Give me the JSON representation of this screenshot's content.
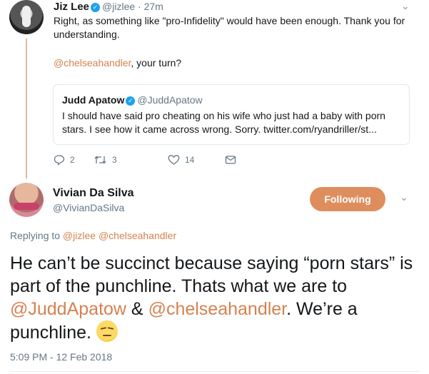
{
  "tweet1": {
    "name": "Jiz Lee",
    "handle": "@jizlee",
    "time": "· 27m",
    "text": "Right, as something like \"pro-Infidelity\" would have been enough. Thank you for understanding.",
    "mention": "@chelseahandler",
    "after_mention": ", your turn?",
    "actions": {
      "replies": "2",
      "retweets": "3",
      "likes": "14"
    }
  },
  "quote": {
    "name": "Judd Apatow",
    "handle": "@JuddApatow",
    "text": "I should have said pro cheating on his wife who just had a baby with porn stars.   I see how it came across wrong.  Sorry. twitter.com/ryandriller/st..."
  },
  "tweet2": {
    "name": "Vivian Da Silva",
    "handle": "@VivianDaSilva",
    "follow_label": "Following",
    "replying_prefix": "Replying to",
    "replying_handles": "@jizlee @chelseahandler",
    "text_part1": "He can’t be succinct because saying “porn stars” is part of the punchline. Thats what we are to ",
    "mention1": "@JuddApatow",
    "amp": " & ",
    "mention2": "@chelseahandler",
    "text_part2": ". We’re a punchline. ",
    "timestamp": "5:09 PM - 12 Feb 2018"
  },
  "colors": {
    "accent": "#de8e5d",
    "link": "#d6814f",
    "verified": "#1da1f2",
    "muted": "#657786"
  },
  "icons": [
    "verified-badge-icon",
    "chevron-down-icon",
    "reply-icon",
    "retweet-icon",
    "like-icon",
    "dm-icon",
    "unamused-emoji-icon"
  ]
}
